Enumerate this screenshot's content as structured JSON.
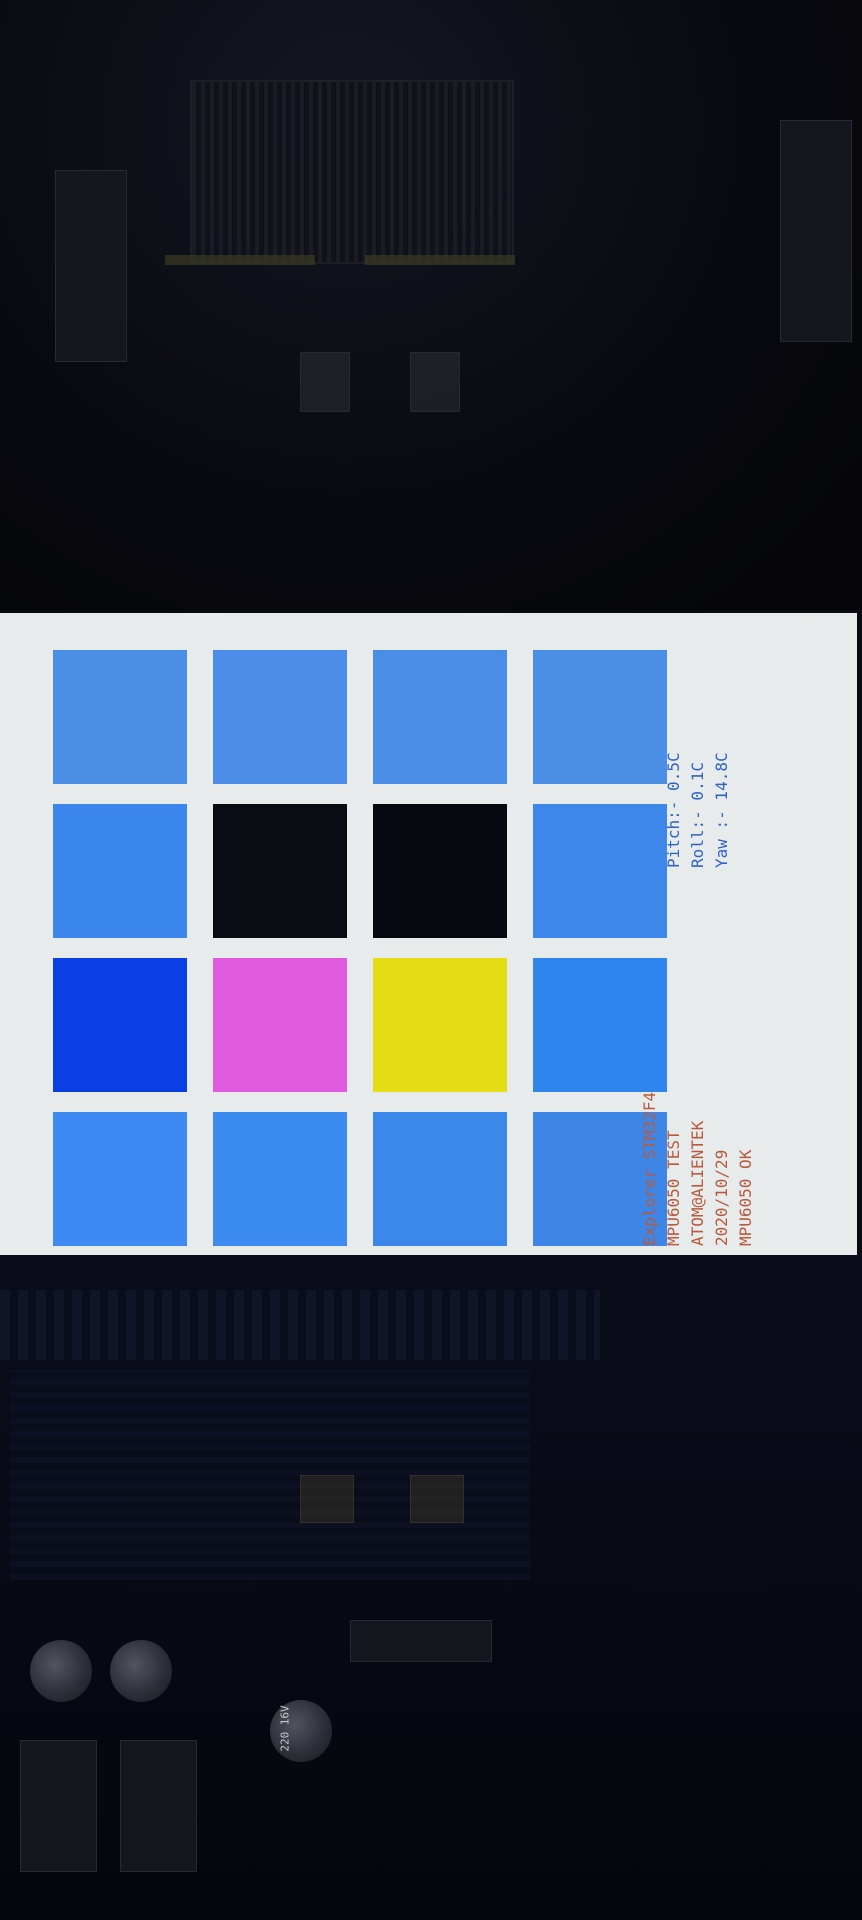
{
  "screen": {
    "status_lines": [
      "Explorer STM32F4",
      "MPU6050 TEST",
      "ATOM@ALIENTEK",
      "2020/10/29",
      "MPU6050 OK"
    ],
    "readings": [
      {
        "label": "Pitch:",
        "value": "- 0.5C"
      },
      {
        "label": "Roll:",
        "value": "- 0.1C"
      },
      {
        "label": "Yaw :",
        "value": "- 14.8C"
      }
    ],
    "grid": {
      "rows": 4,
      "cols": 4,
      "cells": [
        [
          "#3d8af2",
          "#3b8bf0",
          "#3c88ea",
          "#3d86e6"
        ],
        [
          "#0a3fe6",
          "#e05ae0",
          "#e4dc14",
          "#2f85ee"
        ],
        [
          "#3a86ec",
          "#0a0c14",
          "#070910",
          "#3d86ea"
        ],
        [
          "#4a8ee6",
          "#4b8de8",
          "#4a8de6",
          "#4a8ee6"
        ]
      ]
    }
  },
  "board": {
    "capacitor_marking": "220 16V"
  },
  "colors": {
    "status_text": "#b85a3c",
    "readout_text": "#2f63c4",
    "screen_bg": "#e7ebec"
  }
}
